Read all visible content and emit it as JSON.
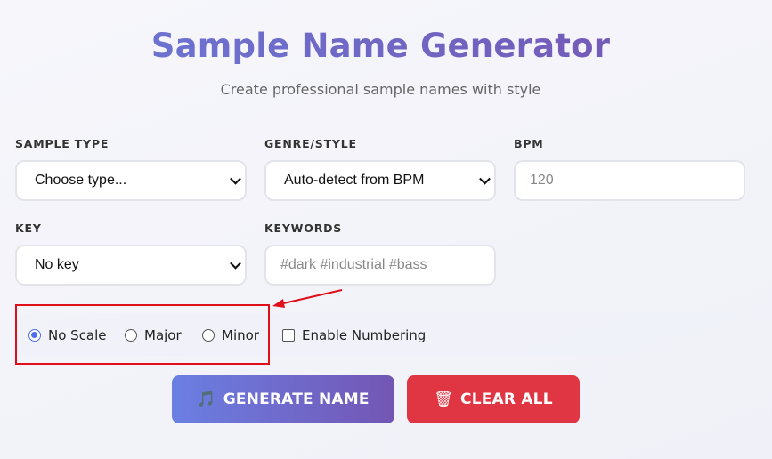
{
  "header": {
    "title": "Sample Name Generator",
    "subtitle": "Create professional sample names with style"
  },
  "form": {
    "sample_type": {
      "label": "SAMPLE TYPE",
      "value": "Choose type..."
    },
    "genre": {
      "label": "GENRE/STYLE",
      "value": "Auto-detect from BPM"
    },
    "bpm": {
      "label": "BPM",
      "placeholder": "120"
    },
    "key": {
      "label": "KEY",
      "value": "No key"
    },
    "keywords": {
      "label": "KEYWORDS",
      "placeholder": "#dark #industrial #bass"
    }
  },
  "options": {
    "scale": [
      {
        "label": "No Scale",
        "selected": true
      },
      {
        "label": "Major",
        "selected": false
      },
      {
        "label": "Minor",
        "selected": false
      }
    ],
    "numbering": {
      "label": "Enable Numbering",
      "checked": false
    }
  },
  "buttons": {
    "generate": {
      "icon": "music-note-icon",
      "label": "GENERATE NAME"
    },
    "clear": {
      "icon": "trash-icon",
      "label": "CLEAR ALL"
    }
  },
  "colors": {
    "accent": "#6b7fe3",
    "accent_dark": "#7356b4",
    "danger": "#e03543",
    "annotation": "#e0101a"
  }
}
